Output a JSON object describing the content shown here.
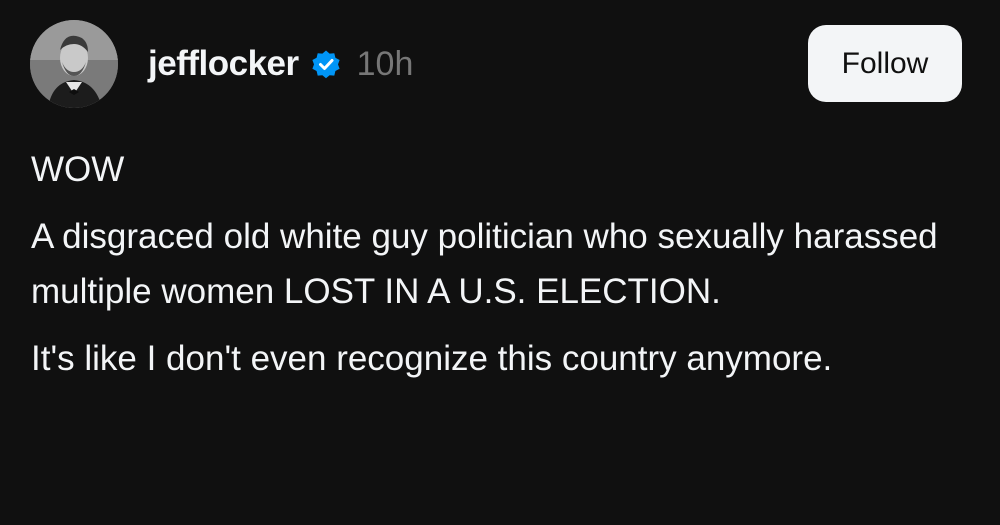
{
  "post": {
    "author": {
      "username": "jefflocker",
      "verified": true,
      "avatar_icon": "profile-photo",
      "verified_icon": "verified-badge-icon"
    },
    "timestamp": "10h",
    "follow_label": "Follow",
    "paragraphs": [
      "WOW",
      "A disgraced old white guy politician who sexually harassed multiple women LOST IN A U.S. ELECTION.",
      "It's like I don't even recognize this country anymore."
    ]
  },
  "colors": {
    "background": "#101010",
    "text": "#f3f5f7",
    "muted": "#777777",
    "verified": "#0095f6",
    "button_bg": "#f3f5f7",
    "button_text": "#101010"
  }
}
